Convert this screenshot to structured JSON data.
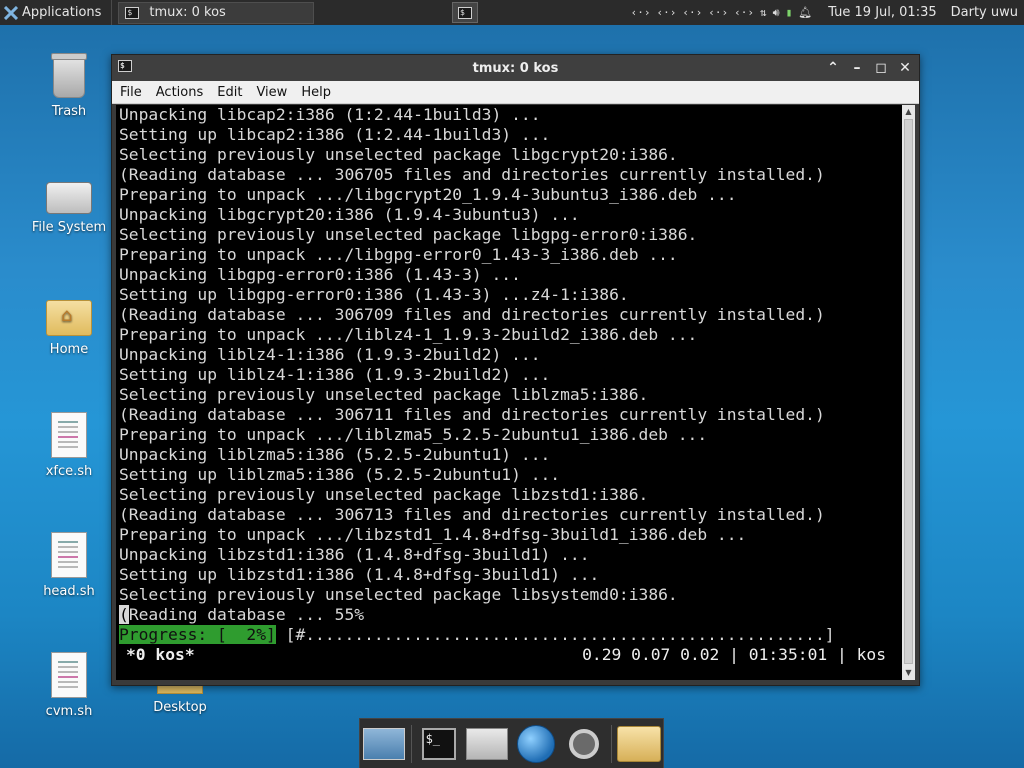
{
  "top_panel": {
    "applications_label": "Applications",
    "task_title": "tmux: 0 kos",
    "clock": "Tue 19 Jul, 01:35",
    "user": "Darty uwu",
    "tray_icons": [
      "network-icon",
      "network-icon",
      "network-icon",
      "network-icon",
      "network-icon",
      "transfer-icon",
      "volume-icon",
      "battery-icon",
      "notification-icon"
    ]
  },
  "desktop": {
    "icons": [
      {
        "label": "Trash",
        "icon": "trash-icon"
      },
      {
        "label": "File System",
        "icon": "disk-icon"
      },
      {
        "label": "Home",
        "icon": "home-folder-icon"
      },
      {
        "label": "xfce.sh",
        "icon": "script-file-icon"
      },
      {
        "label": "head.sh",
        "icon": "script-file-icon"
      },
      {
        "label": "cvm.sh",
        "icon": "script-file-icon"
      },
      {
        "label": "Desktop",
        "icon": "folder-icon"
      }
    ]
  },
  "window": {
    "title": "tmux: 0 kos",
    "menu": [
      "File",
      "Actions",
      "Edit",
      "View",
      "Help"
    ],
    "terminal_lines": [
      "Unpacking libcap2:i386 (1:2.44-1build3) ...",
      "Setting up libcap2:i386 (1:2.44-1build3) ...",
      "Selecting previously unselected package libgcrypt20:i386.",
      "(Reading database ... 306705 files and directories currently installed.)",
      "Preparing to unpack .../libgcrypt20_1.9.4-3ubuntu3_i386.deb ...",
      "Unpacking libgcrypt20:i386 (1.9.4-3ubuntu3) ...",
      "Selecting previously unselected package libgpg-error0:i386.",
      "Preparing to unpack .../libgpg-error0_1.43-3_i386.deb ...",
      "Unpacking libgpg-error0:i386 (1.43-3) ...",
      "Setting up libgpg-error0:i386 (1.43-3) ...z4-1:i386.",
      "(Reading database ... 306709 files and directories currently installed.)",
      "Preparing to unpack .../liblz4-1_1.9.3-2build2_i386.deb ...",
      "Unpacking liblz4-1:i386 (1.9.3-2build2) ...",
      "Setting up liblz4-1:i386 (1.9.3-2build2) ...",
      "Selecting previously unselected package liblzma5:i386.",
      "(Reading database ... 306711 files and directories currently installed.)",
      "Preparing to unpack .../liblzma5_5.2.5-2ubuntu1_i386.deb ...",
      "Unpacking liblzma5:i386 (5.2.5-2ubuntu1) ...",
      "Setting up liblzma5:i386 (5.2.5-2ubuntu1) ...",
      "Selecting previously unselected package libzstd1:i386.",
      "(Reading database ... 306713 files and directories currently installed.)",
      "Preparing to unpack .../libzstd1_1.4.8+dfsg-3build1_i386.deb ...",
      "Unpacking libzstd1:i386 (1.4.8+dfsg-3build1) ...",
      "Setting up libzstd1:i386 (1.4.8+dfsg-3build1) ...",
      "Selecting previously unselected package libsystemd0:i386."
    ],
    "cursor_char": "(",
    "reading_line_rest": "Reading database ... 55%",
    "progress_label": "Progress: [  2%]",
    "progress_bar": " [#.....................................................]",
    "progress_value": 0.02,
    "status_left": "*0 kos*",
    "status_right": "0.29 0.07 0.02 | 01:35:01 | kos"
  },
  "dock": {
    "items": [
      "show-desktop-icon",
      "terminal-icon",
      "file-manager-icon",
      "web-browser-icon",
      "app-finder-icon",
      "folder-icon"
    ],
    "terminal_prompt": "$_"
  }
}
